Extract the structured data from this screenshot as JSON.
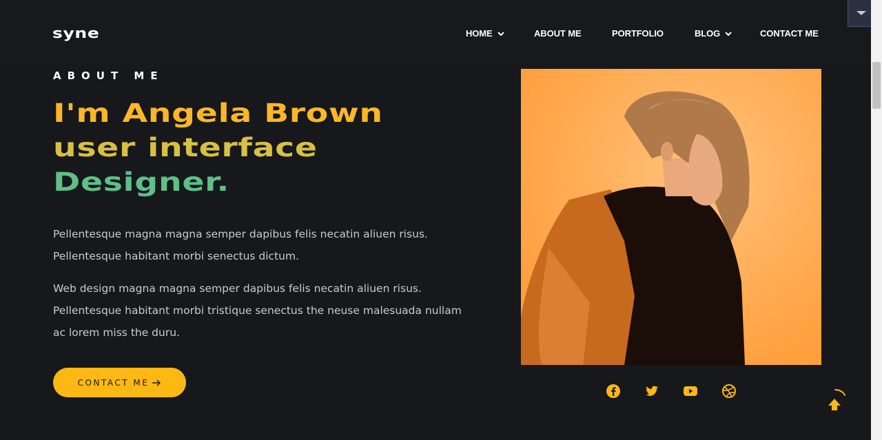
{
  "header": {
    "logo": "syne",
    "nav": [
      {
        "label": "HOME",
        "has_dropdown": true
      },
      {
        "label": "ABOUT ME",
        "has_dropdown": false
      },
      {
        "label": "PORTFOLIO",
        "has_dropdown": false
      },
      {
        "label": "BLOG",
        "has_dropdown": true
      },
      {
        "label": "CONTACT ME",
        "has_dropdown": false
      }
    ]
  },
  "hero": {
    "section_label": "ABOUT ME",
    "headline": [
      "I'm Angela Brown",
      "user interface",
      "Designer."
    ],
    "paragraphs": [
      "Pellentesque magna magna semper dapibus felis necatin aliuen risus. Pellentesque habitant morbi senectus dictum.",
      "Web design magna magna semper dapibus felis necatin aliuen risus. Pellentesque habitant morbi tristique senectus the neuse malesuada nullam ac lorem miss the duru."
    ],
    "cta_label": "CONTACT ME"
  },
  "social": [
    "facebook-icon",
    "twitter-icon",
    "youtube-icon",
    "dribbble-icon"
  ],
  "colors": {
    "accent": "#fdb813",
    "headline_1": "#fbb726",
    "headline_2": "#d7c043",
    "headline_3": "#5fbf86",
    "background": "#17181c"
  }
}
